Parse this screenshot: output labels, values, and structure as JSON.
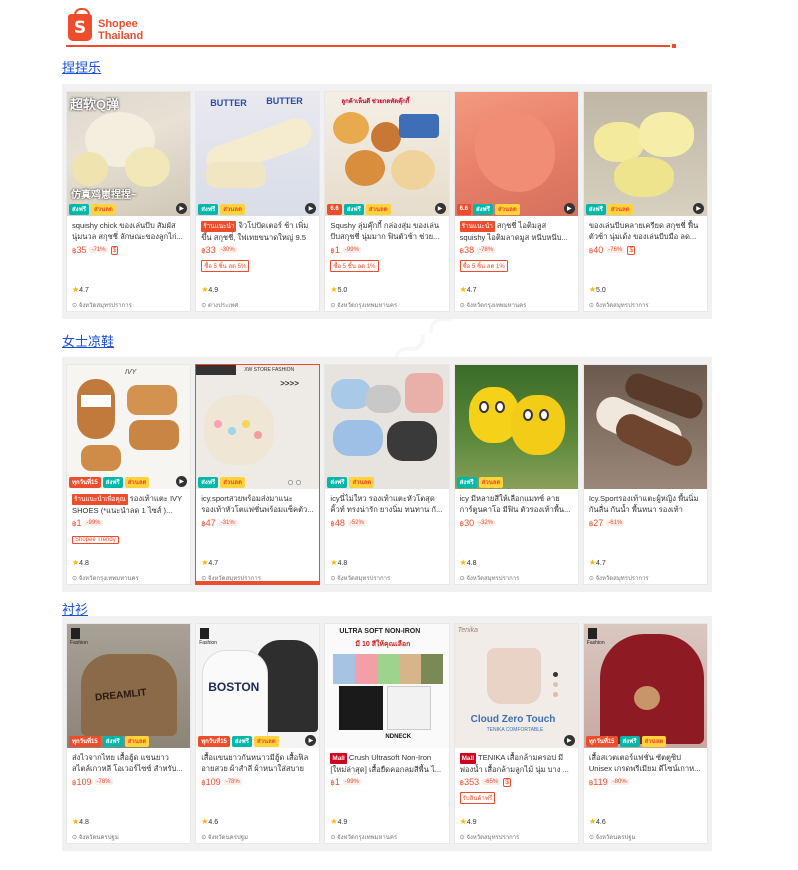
{
  "brand": {
    "line1": "Shopee",
    "line2": "Thailand",
    "logo_letter": "S"
  },
  "sections": [
    {
      "title": "捏捏乐",
      "items": [
        {
          "name": "squishy chick ของเล่นบีบ สัมผัสนุ่มนวล สกุชชี่ ลักษณะของลูกไก่...",
          "price": "35",
          "discount": "-71%",
          "promo": "",
          "rating": "4.7",
          "location": "จังหวัดสมุทรปราการ",
          "label": "",
          "img_text": "超软Q弹",
          "img_text2": "仿真鸡崽捏捏~",
          "strip": [
            "ส่งฟรี",
            "ส่วนลด"
          ]
        },
        {
          "name": "จิวโปปัดเตอร์ ช้า เพิ่มขึ้น สกุชชี่, ใฟเทยขนาดใหญ่ 9.5 นิ้ว...",
          "price": "33",
          "discount": "-30%",
          "promo": "ซื้อ 5 ชิ้น ลด 5%",
          "rating": "4.9",
          "location": "ต่างประเทศ",
          "label": "ร้านแนะนำ",
          "img_text": "BUTTER",
          "img_text2": "",
          "strip": [
            "ส่งฟรี",
            "ส่วนลด"
          ]
        },
        {
          "name": "Squshy ลุ่มคุ๊กกี้ กล่องสุ่ม ของเล่นบีบสกุชชี่ นุ่มมาก ฟินตัวช้า ช่วย...",
          "price": "1",
          "discount": "-99%",
          "promo": "ซื้อ 5 ชิ้น ลด 1%",
          "rating": "5.0",
          "location": "จังหวัดกรุงเทพมหานคร",
          "label": "",
          "img_text": "ลูกค้าเห็นดี ช่วยกดทัดคุ๊กกี้",
          "img_text2": "",
          "strip": [
            "6.6",
            "ส่งฟรี",
            "ส่วนลด"
          ]
        },
        {
          "name": "สกุชชี่ ไอติมลูส squishy ไอติมลาดมูส หนีบหนีบ...",
          "price": "38",
          "discount": "-78%",
          "promo": "ซื้อ 5 ชิ้น ลด 1%",
          "rating": "4.7",
          "location": "จังหวัดกรุงเทพมหานคร",
          "label": "ร้านแนะนำ",
          "img_text": "",
          "img_text2": "",
          "strip": [
            "6.6",
            "ส่งฟรี",
            "ส่วนลด"
          ]
        },
        {
          "name": "ของเล่นบีบคลายเครียด สกุชชี่ ฟื้นตัวช้า นุ่มเด้ง ของเล่นบีบมือ ลด...",
          "price": "40",
          "discount": "-76%",
          "promo": "",
          "rating": "5.0",
          "location": "จังหวัดสมุทรปราการ",
          "label": "",
          "img_text": "",
          "img_text2": "",
          "strip": [
            "ส่งฟรี",
            "ส่วนลด"
          ]
        }
      ]
    },
    {
      "title": "女士凉鞋",
      "items": [
        {
          "name": "รองเท้าแตะ IVY SHOES (*แนะนำลด 1 ไซส์ )...",
          "price": "1",
          "discount": "-99%",
          "promo": "Shopee Trendy",
          "rating": "4.8",
          "location": "จังหวัดกรุงเทพมหานคร",
          "label": "ร้านแนะนำเพื่อคุณ",
          "img_text": "IVY",
          "img_text2": "",
          "strip": [
            "ทุกวันที่15",
            "ส่งฟรี",
            "ส่วนลด"
          ]
        },
        {
          "name": "icy.sportสวยพร้อมส่งมาแนะรองเท้าหัวโตแฟชั่นพร้อมแซ็คตัว...",
          "price": "47",
          "discount": "-31%",
          "promo": "",
          "rating": "4.7",
          "location": "จังหวัดสมุทรปราการ",
          "label": "",
          "img_text": "XW STORE FASHION",
          "img_text2": "",
          "strip": [
            "ส่งฟรี",
            "ส่วนลด"
          ]
        },
        {
          "name": "icyนี่ไม่ใหว รองเท้าแตะหัวโตสุดคิ้วท์ ทรงน่ารัก ยางนิ่ม ทนทาน กั...",
          "price": "48",
          "discount": "-52%",
          "promo": "",
          "rating": "4.8",
          "location": "จังหวัดสมุทรปราการ",
          "label": "",
          "img_text": "",
          "img_text2": "",
          "strip": [
            "ส่งฟรี",
            "ส่วนลด"
          ]
        },
        {
          "name": "icy มีหลายสีให้เลือกแมทช์ ลายการ์ตูนคาโอ มีฟิน ตัวรองเท้าพื้น...",
          "price": "30",
          "discount": "-32%",
          "promo": "",
          "rating": "4.8",
          "location": "จังหวัดสมุทรปราการ",
          "label": "",
          "img_text": "",
          "img_text2": "",
          "strip": [
            "ส่งฟรี",
            "ส่วนลด"
          ]
        },
        {
          "name": "Icy.Sportรองเท้าแตะผู้หญิง พื้นนิ่มกันลื่น กันน้ำ พื้นหนา รองเท้าแตะ...",
          "price": "27",
          "discount": "-61%",
          "promo": "",
          "rating": "4.7",
          "location": "จังหวัดสมุทรปราการ",
          "label": "",
          "img_text": "",
          "img_text2": "",
          "strip": []
        }
      ]
    },
    {
      "title": "衬衫",
      "items": [
        {
          "name": "ส่งไวจากไทย เสื้อฮู้ด แขนยาว สไตล์เกาหลี โอเวอร์ไซซ์ สำหรับ...",
          "price": "109",
          "discount": "-78%",
          "promo": "",
          "rating": "4.8",
          "location": "จังหวัดนครปฐม",
          "label": "",
          "img_text": "DREAMLIT",
          "img_text2": "Fashion",
          "strip": [
            "ทุกวันที่15",
            "ส่งฟรี",
            "ส่วนลด"
          ]
        },
        {
          "name": "เสื้อแขนยาวกันหนาวมีฮู้ด เสื้อฟิลอายสวย ผ้าสำลี ผ้าหนาใส่สบาย",
          "price": "109",
          "discount": "-78%",
          "promo": "",
          "rating": "4.6",
          "location": "จังหวัดนครปฐม",
          "label": "",
          "img_text": "BOSTON",
          "img_text2": "Fashion",
          "strip": [
            "ทุกวันที่15",
            "ส่งฟรี",
            "ส่วนลด"
          ]
        },
        {
          "name": "Crush Ultrasoft Non-Iron [ใหม่ล่าสุด] เสื้อยืดคอกลมสีพื้น ไ...",
          "price": "1",
          "discount": "-99%",
          "promo": "",
          "rating": "4.9",
          "location": "จังหวัดกรุงเทพมหานคร",
          "label": "Mall",
          "img_text": "ULTRA SOFT NON-IRON",
          "img_text2": "มี 10 สีให้คุณเลือก",
          "strip": []
        },
        {
          "name": "TENIKA เสื้อกล้ามครอป มีฟองน้ำ เสื้อกล้ามลูกไม้ นุ่ม บาง ...",
          "price": "353",
          "discount": "-65%",
          "promo": "รับสินค้าฟรี",
          "rating": "4.9",
          "location": "จังหวัดสมุทรปราการ",
          "label": "Mall",
          "img_text": "Cloud Zero Touch",
          "img_text2": "TENIKA COMFORTABLE",
          "strip": []
        },
        {
          "name": "เสื้อสเวตเตอร์แฟชั่น ซัตตูซิป Unisex เกรดพรีเมียม ดีไซน์เกาห...",
          "price": "119",
          "discount": "-80%",
          "promo": "",
          "rating": "4.6",
          "location": "จังหวัดนครปฐม",
          "label": "",
          "img_text": "",
          "img_text2": "Fashion",
          "strip": [
            "ทุกวันที่15",
            "ส่งฟรี",
            "ส่วนลด"
          ]
        }
      ]
    }
  ]
}
